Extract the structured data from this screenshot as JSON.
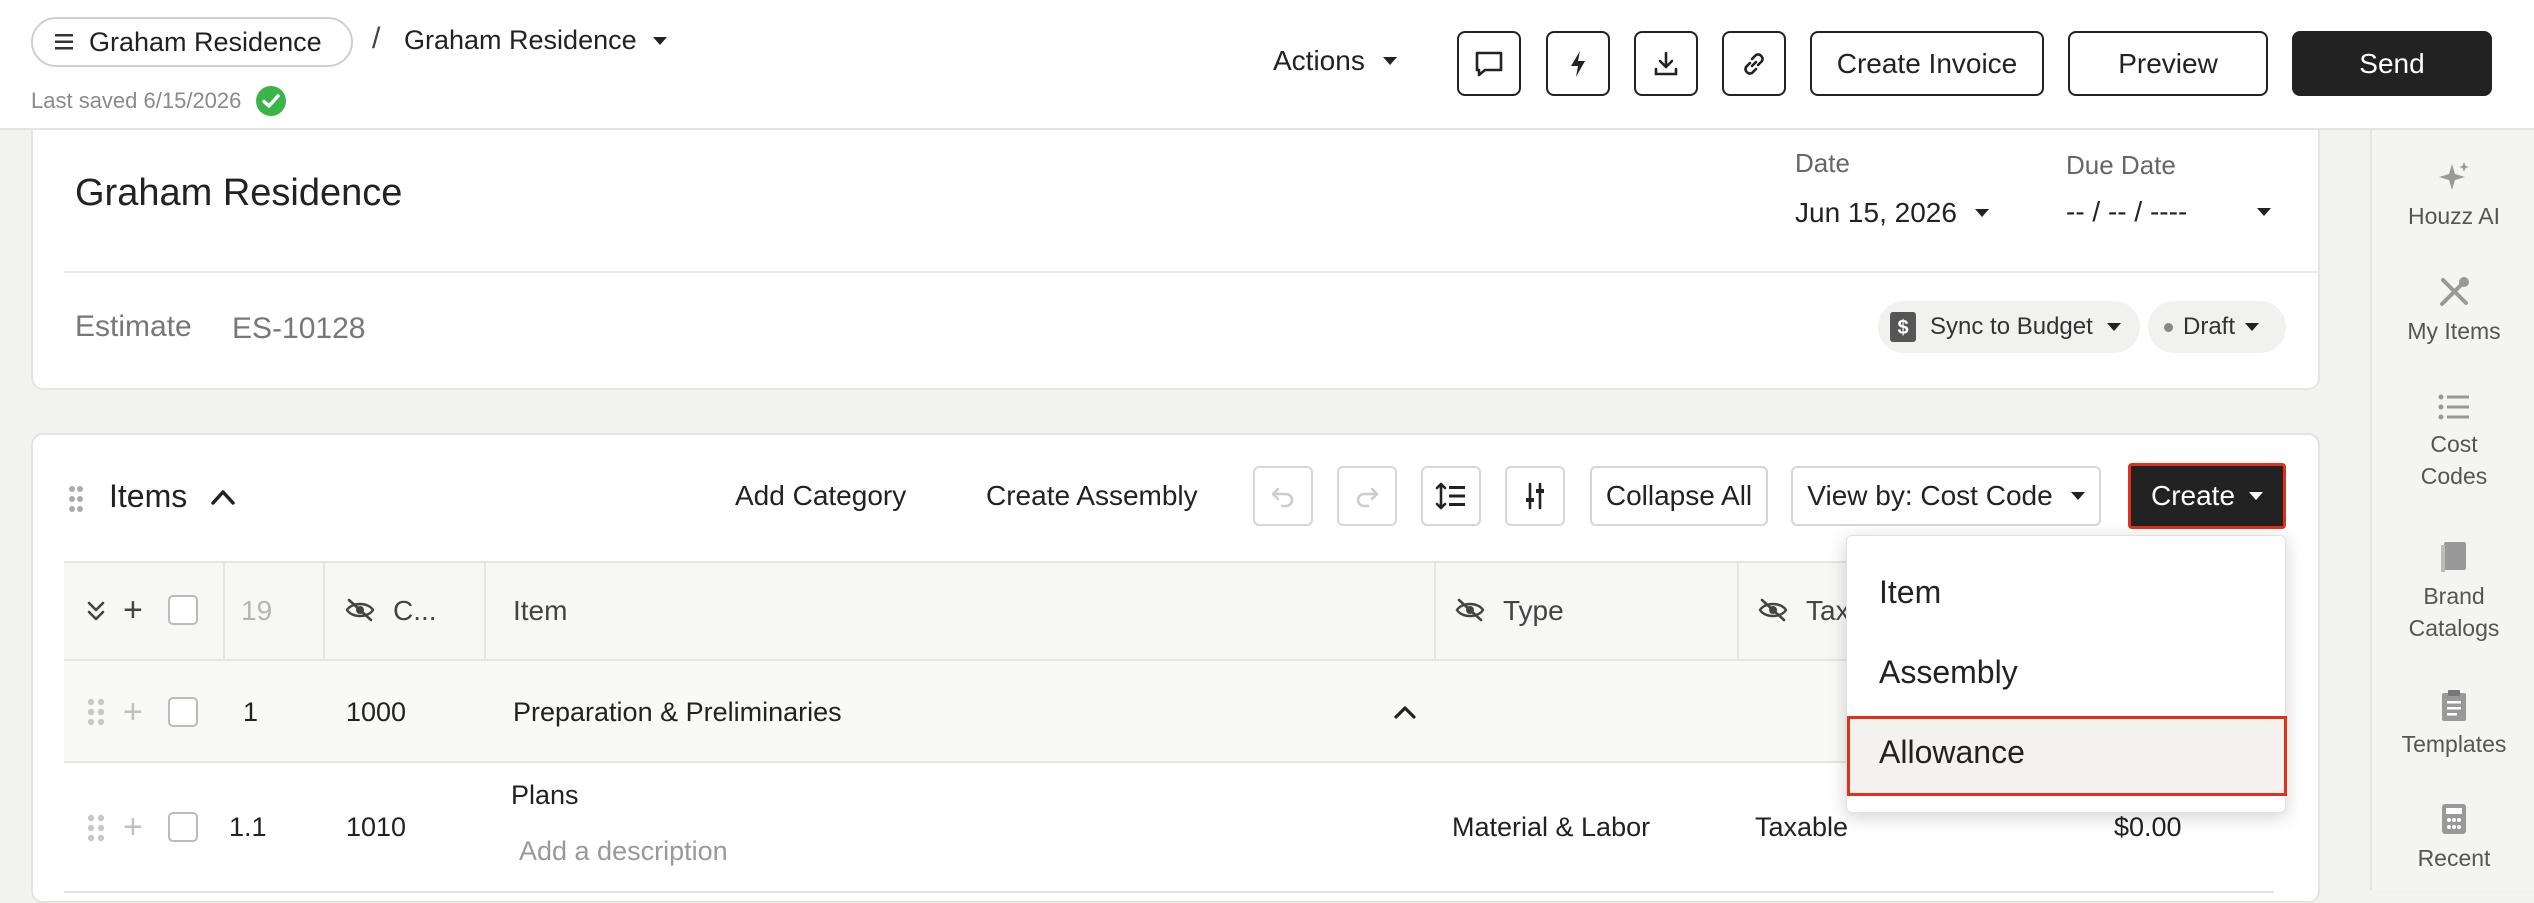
{
  "header": {
    "project_pill": "Graham Residence",
    "separator": "/",
    "breadcrumb": "Graham Residence",
    "last_saved": "Last saved 6/15/2026",
    "actions_label": "Actions",
    "create_invoice": "Create Invoice",
    "preview": "Preview",
    "send": "Send",
    "icons": [
      "comment-icon",
      "bolt-icon",
      "download-icon",
      "link-icon"
    ]
  },
  "sidebar": {
    "items": [
      {
        "label": "Houzz AI",
        "icon": "sparkle-icon"
      },
      {
        "label": "My Items",
        "icon": "tools-icon"
      },
      {
        "label": "Cost Codes",
        "icon": "list-icon"
      },
      {
        "label": "Brand Catalogs",
        "icon": "book-icon"
      },
      {
        "label": "Templates",
        "icon": "clipboard-icon"
      },
      {
        "label": "Recent",
        "icon": "calculator-icon"
      }
    ]
  },
  "document": {
    "title": "Graham Residence",
    "date_label": "Date",
    "date_value": "Jun 15, 2026",
    "due_date_label": "Due Date",
    "due_date_value": "-- / -- / ----",
    "estimate_label": "Estimate",
    "estimate_number": "ES-10128",
    "sync_label": "Sync to Budget",
    "status_label": "Draft"
  },
  "items": {
    "title": "Items",
    "add_category": "Add Category",
    "create_assembly": "Create Assembly",
    "collapse_all": "Collapse All",
    "view_by": "View by: Cost Code",
    "create": "Create",
    "columns": {
      "count": "19",
      "code": "C...",
      "item": "Item",
      "type": "Type",
      "tax": "Tax"
    },
    "rows": [
      {
        "num": "1",
        "code": "1000",
        "item": "Preparation & Preliminaries",
        "type": "",
        "tax": "",
        "amount": ""
      },
      {
        "num": "1.1",
        "code": "1010",
        "item": "Plans",
        "description_placeholder": "Add a description",
        "type": "Material & Labor",
        "tax": "Taxable",
        "amount": "$0.00"
      }
    ]
  },
  "create_menu": {
    "options": [
      "Item",
      "Assembly",
      "Allowance"
    ],
    "highlighted": "Allowance"
  },
  "colors": {
    "accent_dark": "#222222",
    "highlight_red": "#e0311c",
    "saved_check": "#3bb54a"
  }
}
